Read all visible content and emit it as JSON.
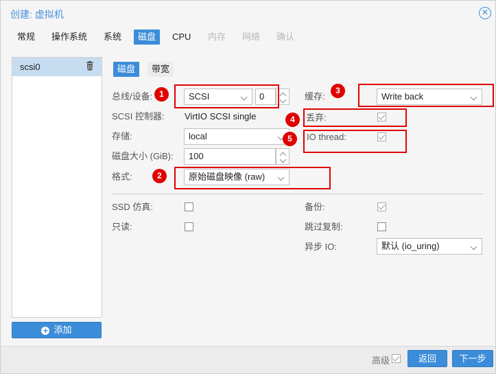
{
  "window": {
    "title": "创建: 虚拟机",
    "close_icon": "close-circle-icon"
  },
  "tabs": [
    {
      "label": "常规",
      "state": "normal"
    },
    {
      "label": "操作系统",
      "state": "normal"
    },
    {
      "label": "系统",
      "state": "normal"
    },
    {
      "label": "磁盘",
      "state": "active"
    },
    {
      "label": "CPU",
      "state": "normal"
    },
    {
      "label": "内存",
      "state": "disabled"
    },
    {
      "label": "网络",
      "state": "disabled"
    },
    {
      "label": "确认",
      "state": "disabled"
    }
  ],
  "disk_list": {
    "items": [
      {
        "label": "scsi0",
        "icon": "trash-icon"
      }
    ],
    "add_label": "添加"
  },
  "subtabs": [
    {
      "label": "磁盘",
      "state": "active"
    },
    {
      "label": "带宽",
      "state": "normal"
    }
  ],
  "form": {
    "bus_label": "总线/设备:",
    "bus_value": "SCSI",
    "device_value": "0",
    "controller_label": "SCSI 控制器:",
    "controller_value": "VirtIO SCSI single",
    "storage_label": "存储:",
    "storage_value": "local",
    "size_label": "磁盘大小 (GiB):",
    "size_value": "100",
    "format_label": "格式:",
    "format_value": "原始磁盘映像 (raw)",
    "cache_label": "缓存:",
    "cache_value": "Write back",
    "discard_label": "丢弃:",
    "discard_checked": true,
    "iothread_label": "IO thread:",
    "iothread_checked": true,
    "ssd_label": "SSD 仿真:",
    "ssd_checked": false,
    "readonly_label": "只读:",
    "readonly_checked": false,
    "backup_label": "备份:",
    "backup_checked": true,
    "skip_repl_label": "跳过复制:",
    "skip_repl_checked": false,
    "async_label": "异步 IO:",
    "async_value": "默认 (io_uring)"
  },
  "annotations": {
    "badges": [
      "1",
      "2",
      "3",
      "4",
      "5"
    ],
    "color": "#e00000"
  },
  "footer": {
    "advanced_label": "高级",
    "advanced_checked": true,
    "back_label": "返回",
    "next_label": "下一步"
  },
  "colors": {
    "accent": "#3c8dd9",
    "annotation": "#e00000",
    "selected_row": "#c6dcf1"
  }
}
